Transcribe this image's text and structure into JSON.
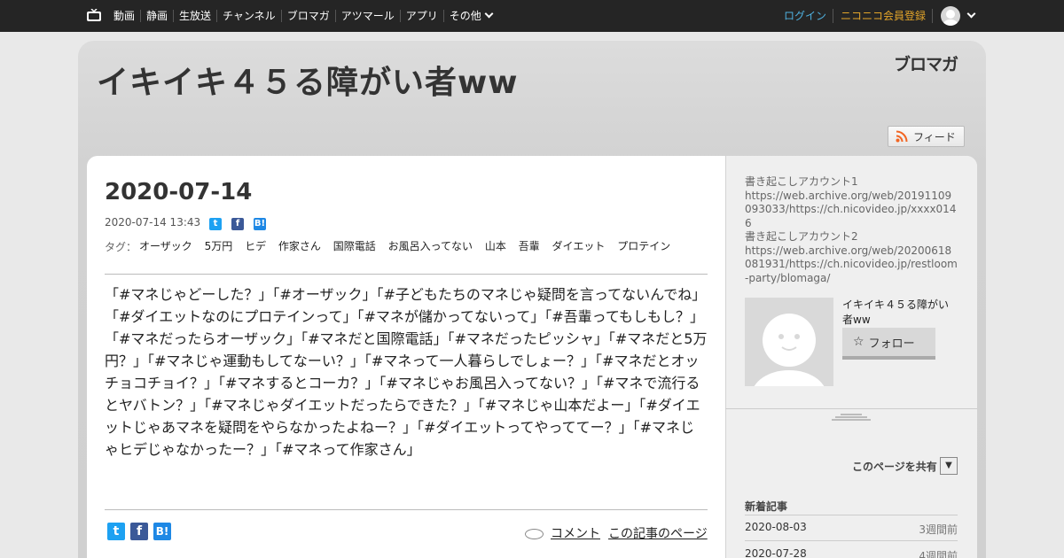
{
  "nav": {
    "items": [
      "動画",
      "静画",
      "生放送",
      "チャンネル",
      "ブロマガ",
      "アツマール",
      "アプリ",
      "その他"
    ],
    "login": "ログイン",
    "signup": "ニコニコ会員登録"
  },
  "blog": {
    "title": "イキイキ４５る障がい者ww",
    "logo": "ブロマガ",
    "feed_label": "フィード"
  },
  "article": {
    "date_title": "2020-07-14",
    "timestamp": "2020-07-14 13:43",
    "tags_label": "タグ：",
    "tags": [
      "オーザック",
      "5万円",
      "ヒデ",
      "作家さん",
      "国際電話",
      "お風呂入ってない",
      "山本",
      "吾輩",
      "ダイエット",
      "プロテイン"
    ],
    "body": "「#マネじゃどーした？」「#オーザック」「#子どもたちのマネじゃ疑問を言ってないんでね」「#ダイエットなのにプロテインって」「#マネが儲かってないって」「#吾輩ってもしもし？」「#マネだったらオーザック」「#マネだと国際電話」「#マネだったピッシャ」「#マネだと5万円？」「#マネじゃ運動もしてなーい？」「#マネって一人暮らしでしょー？」「#マネだとオッチョコチョイ？」「#マネするとコーカ？」「#マネじゃお風呂入ってない？」「#マネで流行るとヤバトン？」「#マネじゃダイエットだったらできた？」「#マネじゃ山本だよー」「#ダイエットじゃあマネを疑問をやらなかったよねー？」「#ダイエットってやっててー？」「#マネじゃヒデじゃなかったー？」「#マネって作家さん」",
    "comment_label": "コメント",
    "page_label": "この記事のページ"
  },
  "sidebar": {
    "description": "書き起こしアカウント1\nhttps://web.archive.org/web/20191109093033/https://ch.nicovideo.jp/xxxx0146\n書き起こしアカウント2\nhttps://web.archive.org/web/20200618081931/https://ch.nicovideo.jp/restloom-party/blomaga/",
    "profile_name": "イキイキ４５る障がい者ww",
    "follow_label": "フォロー",
    "share_label": "このページを共有",
    "share_dropdown": "▼",
    "recent_heading": "新着記事",
    "recent": [
      {
        "date": "2020-08-03",
        "ago": "3週間前"
      },
      {
        "date": "2020-07-28",
        "ago": "4週間前"
      }
    ]
  },
  "colors": {
    "topbar": "#252525",
    "login": "#4fb1e0",
    "signup": "#e3a52a",
    "twitter": "#1da1f2",
    "facebook": "#3b5998",
    "hatena": "#1e88e5"
  }
}
